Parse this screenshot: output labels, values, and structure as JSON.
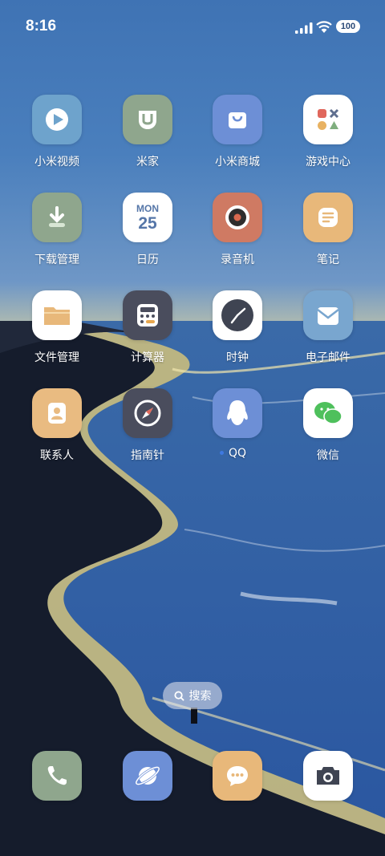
{
  "status_bar": {
    "time": "8:16",
    "battery": "100",
    "icons": [
      "signal-icon",
      "wifi-icon",
      "battery-icon"
    ]
  },
  "apps": [
    {
      "label": "小米视频",
      "icon": "video-play-icon",
      "color": "#6ea3cc"
    },
    {
      "label": "米家",
      "icon": "mijia-icon",
      "color": "#8fa68d"
    },
    {
      "label": "小米商城",
      "icon": "shopping-bag-icon",
      "color": "#6d8fd6"
    },
    {
      "label": "游戏中心",
      "icon": "game-shapes-icon",
      "color": "#ffffff"
    },
    {
      "label": "下载管理",
      "icon": "download-icon",
      "color": "#8fa68d"
    },
    {
      "label": "日历",
      "icon": "calendar-icon",
      "color": "#ffffff",
      "day": "MON",
      "date": "25"
    },
    {
      "label": "录音机",
      "icon": "recorder-icon",
      "color": "#cf7a63"
    },
    {
      "label": "笔记",
      "icon": "notes-icon",
      "color": "#e8b87a"
    },
    {
      "label": "文件管理",
      "icon": "folder-icon",
      "color": "#ffffff"
    },
    {
      "label": "计算器",
      "icon": "calculator-icon",
      "color": "#4a4d5d"
    },
    {
      "label": "时钟",
      "icon": "clock-icon",
      "color": "#ffffff"
    },
    {
      "label": "电子邮件",
      "icon": "mail-icon",
      "color": "#79a6cf"
    },
    {
      "label": "联系人",
      "icon": "contact-icon",
      "color": "#e9bb81"
    },
    {
      "label": "指南针",
      "icon": "compass-icon",
      "color": "#4a4d5d"
    },
    {
      "label": "QQ",
      "icon": "qq-penguin-icon",
      "color": "#6d8fd6"
    },
    {
      "label": "微信",
      "icon": "wechat-icon",
      "color": "#ffffff"
    }
  ],
  "search": {
    "label": "搜索"
  },
  "dock": [
    {
      "name": "phone",
      "icon": "phone-icon",
      "color": "#8fa68d"
    },
    {
      "name": "browser",
      "icon": "planet-icon",
      "color": "#6d8fd6"
    },
    {
      "name": "messages",
      "icon": "message-bubble-icon",
      "color": "#e8b87a"
    },
    {
      "name": "camera",
      "icon": "camera-icon",
      "color": "#ffffff"
    }
  ]
}
